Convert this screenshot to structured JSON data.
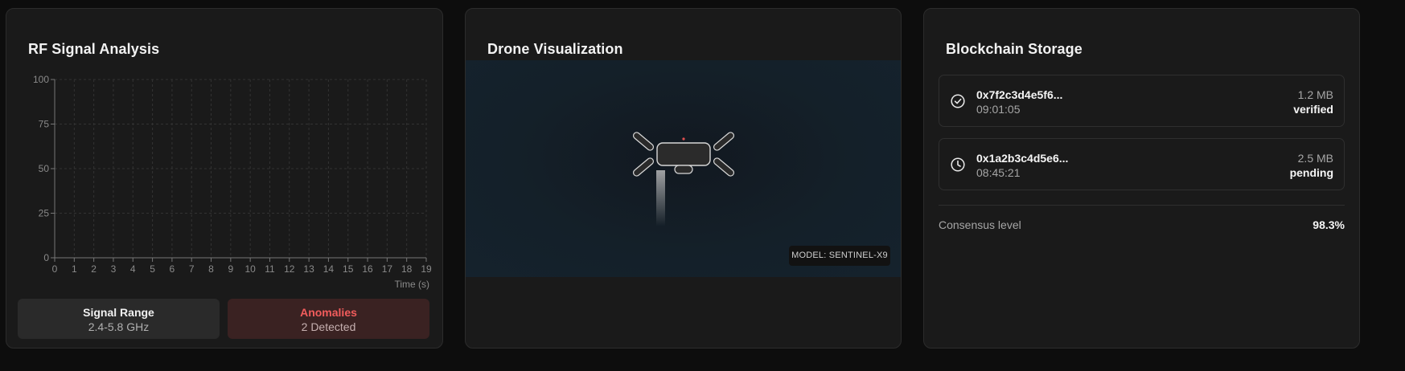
{
  "rf_panel": {
    "title": "RF Signal Analysis",
    "chart_data": {
      "type": "line",
      "title": "",
      "xlabel": "Time (s)",
      "ylabel": "",
      "x_ticks": [
        "0",
        "1",
        "2",
        "3",
        "4",
        "5",
        "6",
        "7",
        "8",
        "9",
        "10",
        "11",
        "12",
        "13",
        "14",
        "15",
        "16",
        "17",
        "18",
        "19"
      ],
      "y_ticks": [
        "0",
        "25",
        "50",
        "75",
        "100"
      ],
      "xlim": [
        0,
        19
      ],
      "ylim": [
        0,
        100
      ],
      "grid": true,
      "series": []
    },
    "stats": {
      "range_label": "Signal Range",
      "range_value": "2.4-5.8 GHz",
      "anomalies_label": "Anomalies",
      "anomalies_value": "2 Detected"
    }
  },
  "drone_panel": {
    "title": "Drone Visualization",
    "model_badge": "MODEL: SENTINEL-X9"
  },
  "chain_panel": {
    "title": "Blockchain Storage",
    "blocks": [
      {
        "hash": "0x7f2c3d4e5f6...",
        "time": "09:01:05",
        "size": "1.2 MB",
        "status": "verified",
        "icon": "check-circle-icon"
      },
      {
        "hash": "0x1a2b3c4d5e6...",
        "time": "08:45:21",
        "size": "2.5 MB",
        "status": "pending",
        "icon": "clock-icon"
      }
    ],
    "consensus_label": "Consensus level",
    "consensus_value": "98.3%"
  },
  "colors": {
    "background": "#0d0d0d",
    "card": "#1a1a1a",
    "anomaly_accent": "#f25c5c",
    "drone_marker": "#e05050"
  }
}
